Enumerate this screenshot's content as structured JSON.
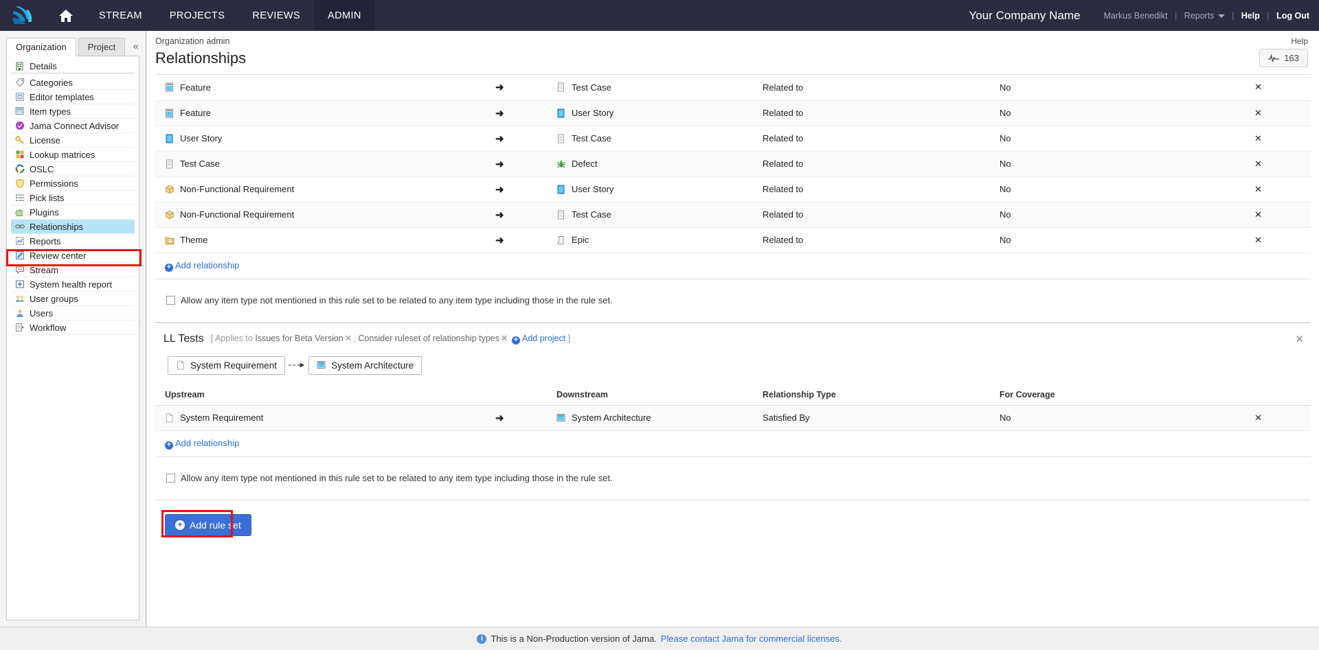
{
  "topnav": {
    "logo_alt": "jama-logo",
    "home_label": "Home",
    "links": [
      {
        "label": "STREAM",
        "active": false
      },
      {
        "label": "PROJECTS",
        "active": false
      },
      {
        "label": "REVIEWS",
        "active": false
      },
      {
        "label": "ADMIN",
        "active": true
      }
    ],
    "company": "Your Company Name",
    "user": "Markus Benedikt",
    "reports": "Reports",
    "help": "Help",
    "logout": "Log Out",
    "separator": "|"
  },
  "sidebar": {
    "tabs": [
      {
        "label": "Organization",
        "active": true
      },
      {
        "label": "Project",
        "active": false
      }
    ],
    "collapse_glyph": "«",
    "items": [
      {
        "label": "Details",
        "icon": "building-icon",
        "selected": false,
        "group_end": true
      },
      {
        "label": "Categories",
        "icon": "tag-icon",
        "selected": false
      },
      {
        "label": "Editor templates",
        "icon": "template-icon",
        "selected": false
      },
      {
        "label": "Item types",
        "icon": "item-types-icon",
        "selected": false
      },
      {
        "label": "Jama Connect Advisor",
        "icon": "advisor-check-icon",
        "selected": false
      },
      {
        "label": "License",
        "icon": "key-icon",
        "selected": false
      },
      {
        "label": "Lookup matrices",
        "icon": "matrix-icon",
        "selected": false
      },
      {
        "label": "OSLC",
        "icon": "oslc-ring-icon",
        "selected": false
      },
      {
        "label": "Permissions",
        "icon": "shield-icon",
        "selected": false
      },
      {
        "label": "Pick lists",
        "icon": "list-icon",
        "selected": false
      },
      {
        "label": "Plugins",
        "icon": "puzzle-icon",
        "selected": false
      },
      {
        "label": "Relationships",
        "icon": "link-icon",
        "selected": true
      },
      {
        "label": "Reports",
        "icon": "chart-icon",
        "selected": false
      },
      {
        "label": "Review center",
        "icon": "pencil-icon",
        "selected": false
      },
      {
        "label": "Stream",
        "icon": "speech-bubble-icon",
        "selected": false
      },
      {
        "label": "System health report",
        "icon": "health-report-icon",
        "selected": false
      },
      {
        "label": "User groups",
        "icon": "user-groups-icon",
        "selected": false
      },
      {
        "label": "Users",
        "icon": "user-icon",
        "selected": false
      },
      {
        "label": "Workflow",
        "icon": "workflow-icon",
        "selected": false
      }
    ]
  },
  "main": {
    "breadcrumb": "Organization admin",
    "help_link": "Help",
    "page_title": "Relationships",
    "pulse_button": {
      "icon": "pulse-icon",
      "value": "163"
    },
    "columns": {
      "upstream": "Upstream",
      "downstream": "Downstream",
      "relationship_type": "Relationship Type",
      "for_coverage": "For Coverage"
    },
    "add_relationship_label": "Add relationship",
    "allow_any_label": "Allow any item type not mentioned in this rule set to be related to any item type including those in the rule set.",
    "allow_any_checked": false,
    "rulesets": [
      {
        "name": "",
        "show_header_row": false,
        "rows": [
          {
            "upstream": "Feature",
            "upstream_icon": "feature-icon",
            "downstream": "Test Case",
            "downstream_icon": "test-case-icon",
            "type": "Related to",
            "coverage": "No"
          },
          {
            "upstream": "Feature",
            "upstream_icon": "feature-icon",
            "downstream": "User Story",
            "downstream_icon": "user-story-icon",
            "type": "Related to",
            "coverage": "No"
          },
          {
            "upstream": "User Story",
            "upstream_icon": "user-story-icon",
            "downstream": "Test Case",
            "downstream_icon": "test-case-icon",
            "type": "Related to",
            "coverage": "No"
          },
          {
            "upstream": "Test Case",
            "upstream_icon": "test-case-icon",
            "downstream": "Defect",
            "downstream_icon": "defect-bug-icon",
            "type": "Related to",
            "coverage": "No"
          },
          {
            "upstream": "Non-Functional Requirement",
            "upstream_icon": "nfr-box-icon",
            "downstream": "User Story",
            "downstream_icon": "user-story-icon",
            "type": "Related to",
            "coverage": "No"
          },
          {
            "upstream": "Non-Functional Requirement",
            "upstream_icon": "nfr-box-icon",
            "downstream": "Test Case",
            "downstream_icon": "test-case-icon",
            "type": "Related to",
            "coverage": "No"
          },
          {
            "upstream": "Theme",
            "upstream_icon": "theme-folder-icon",
            "downstream": "Epic",
            "downstream_icon": "epic-icon",
            "type": "Related to",
            "coverage": "No"
          }
        ]
      },
      {
        "name": "LL Tests",
        "show_header_row": true,
        "meta_open": "[ Applies to",
        "meta_close": "]",
        "applies_to": [
          {
            "label": "Issues for Beta Version",
            "removable": true
          },
          {
            "label": "Consider ruleset of relationship types",
            "removable": true
          }
        ],
        "add_project_label": "Add project",
        "flow": {
          "from": {
            "label": "System Requirement",
            "icon": "system-requirement-icon"
          },
          "to": {
            "label": "System Architecture",
            "icon": "system-architecture-icon"
          },
          "connector": "- - ➜"
        },
        "rows": [
          {
            "upstream": "System Requirement",
            "upstream_icon": "system-requirement-icon",
            "downstream": "System Architecture",
            "downstream_icon": "system-architecture-icon",
            "type": "Satisfied By",
            "coverage": "No"
          }
        ]
      }
    ],
    "add_rule_set_label": "Add rule set"
  },
  "footer": {
    "message": "This is a Non-Production version of Jama.",
    "link": "Please contact Jama for commercial licenses."
  },
  "colors": {
    "nav_bg": "#2b2b42",
    "nav_active": "#23233a",
    "accent_blue": "#2f6ed5",
    "primary_button": "#3a6fd8",
    "selected_row": "#b7e3f7",
    "annotation_red": "#ee1111"
  }
}
